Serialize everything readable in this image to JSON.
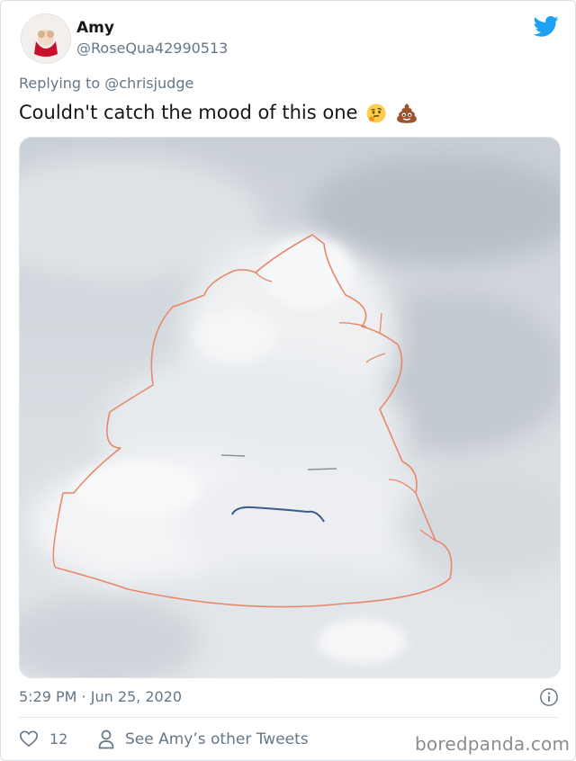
{
  "user": {
    "name": "Amy",
    "handle": "@RoseQua42990513"
  },
  "reply": {
    "prefix": "Replying to",
    "mention": "@chrisjudge"
  },
  "tweet": {
    "text": "Couldn't catch the mood of this one",
    "emojis": [
      "thinking-face",
      "pile-of-poo"
    ],
    "timestamp": "5:29 PM · Jun 25, 2020"
  },
  "actions": {
    "like_count": "12",
    "see_other_label": "See Amy’s other Tweets"
  },
  "watermark": "boredpanda.com",
  "colors": {
    "twitter_blue": "#1da1f2",
    "text_primary": "#14171a",
    "text_secondary": "#657786",
    "drawing_stroke": "#e8886a"
  }
}
